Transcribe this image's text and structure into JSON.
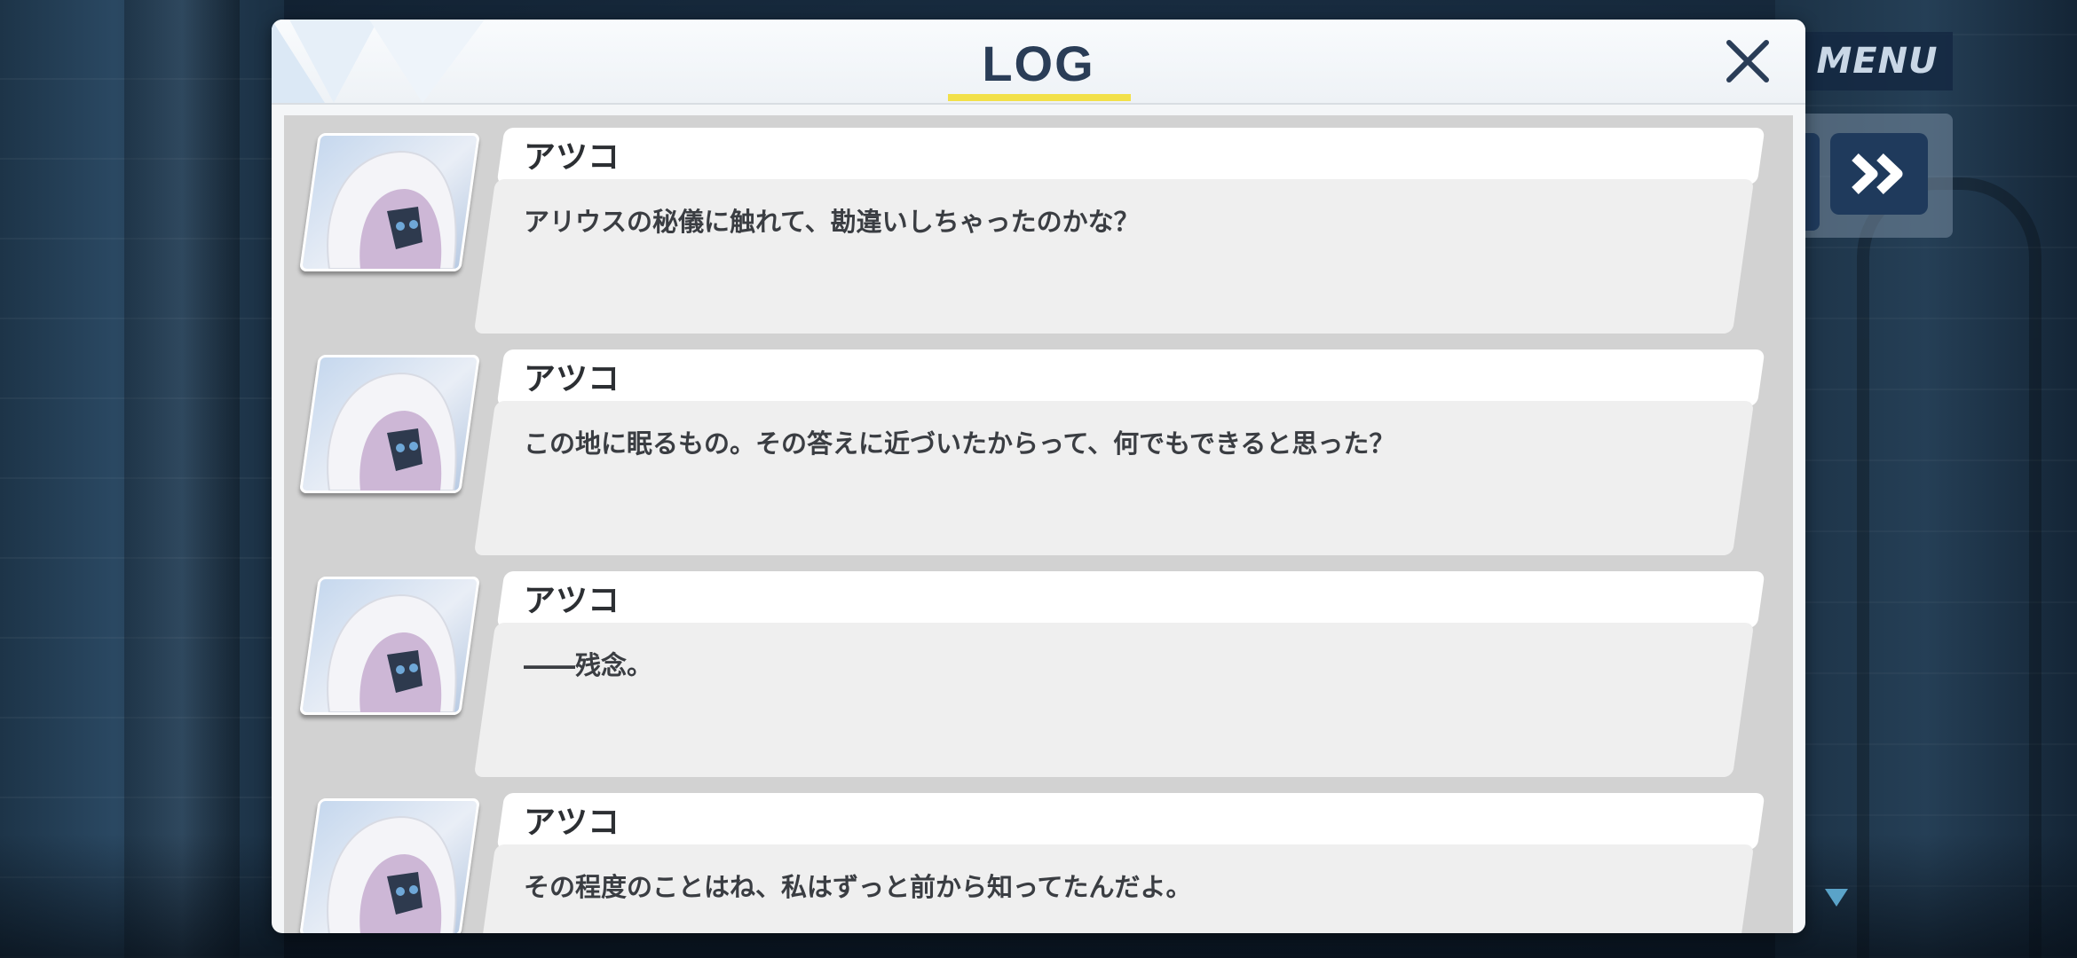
{
  "menu": {
    "label": "MENU"
  },
  "log": {
    "title": "LOG",
    "entries": [
      {
        "speaker": "アツコ",
        "text": "アリウスの秘儀に触れて、勘違いしちゃったのかな？"
      },
      {
        "speaker": "アツコ",
        "text": "この地に眠るもの。その答えに近づいたからって、何でもできると思った？"
      },
      {
        "speaker": "アツコ",
        "text": "――残念。"
      },
      {
        "speaker": "アツコ",
        "text": "その程度のことはね、私はずっと前から知ってたんだよ。"
      }
    ]
  },
  "colors": {
    "title_text": "#2a3d57",
    "title_underline": "#f2e04a",
    "button_bg": "#1f3a5c"
  },
  "icons": {
    "close": "close-icon",
    "skip": "fast-forward-icon",
    "scroll": "triangle-down-icon"
  }
}
